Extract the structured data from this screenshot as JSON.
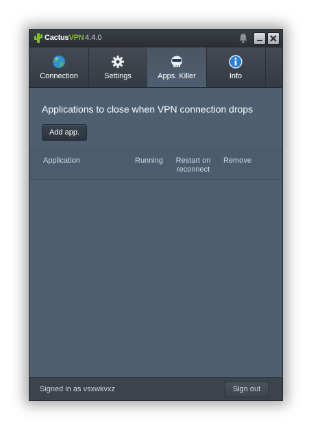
{
  "app": {
    "brand_main": "Cactus",
    "brand_accent": "VPN",
    "version": "4.4.0"
  },
  "tabs": [
    {
      "label": "Connection",
      "icon": "globe-icon",
      "active": false
    },
    {
      "label": "Settings",
      "icon": "gear-icon",
      "active": false
    },
    {
      "label": "Apps. Killer",
      "icon": "skull-icon",
      "active": true
    },
    {
      "label": "Info",
      "icon": "info-icon",
      "active": false
    }
  ],
  "main": {
    "heading": "Applications to close when VPN connection drops",
    "add_button": "Add app."
  },
  "table": {
    "columns": [
      "Application",
      "Running",
      "Restart on reconnect",
      "Remove"
    ],
    "rows": []
  },
  "footer": {
    "signed_in_text": "Signed in as vsxwkvxz",
    "sign_out": "Sign out"
  },
  "colors": {
    "accent": "#7fbf2a",
    "panel": "#4e5f72",
    "titlebar": "#2f3339"
  }
}
